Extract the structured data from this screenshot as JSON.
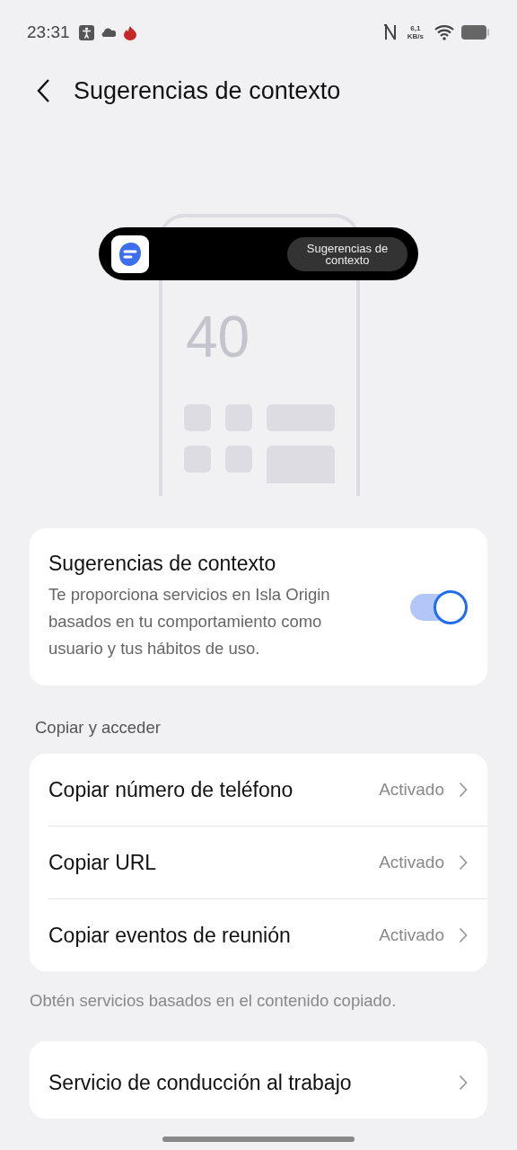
{
  "status_bar": {
    "time": "23:31",
    "speed_value": "6,1",
    "speed_unit": "KB/s"
  },
  "header": {
    "title": "Sugerencias de contexto"
  },
  "illustration": {
    "clock_digits": [
      "40"
    ],
    "island_label": "Sugerencias de contexto"
  },
  "feature_card": {
    "title": "Sugerencias de contexto",
    "description": "Te proporciona servicios en Isla Origin basados en tu comportamiento como usuario y tus hábitos de uso.",
    "on": true
  },
  "copy_section": {
    "heading": "Copiar y acceder",
    "items": [
      {
        "label": "Copiar número de teléfono",
        "value": "Activado"
      },
      {
        "label": "Copiar URL",
        "value": "Activado"
      },
      {
        "label": "Copiar eventos de reunión",
        "value": "Activado"
      }
    ],
    "footnote": "Obtén servicios basados en el contenido copiado."
  },
  "other_items": [
    {
      "label": "Servicio de conducción al trabajo"
    }
  ]
}
